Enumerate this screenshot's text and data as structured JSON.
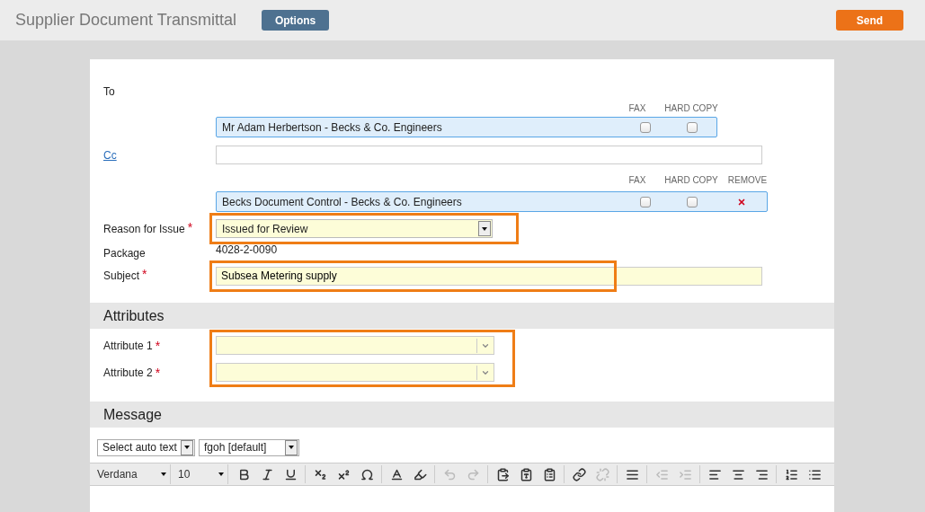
{
  "header": {
    "title": "Supplier Document Transmittal",
    "options_button": "Options",
    "send_button": "Send"
  },
  "to": {
    "label": "To",
    "columns": [
      "FAX",
      "HARD COPY"
    ],
    "recipients": [
      {
        "name": "Mr Adam Herbertson - Becks & Co. Engineers",
        "fax": false,
        "hard_copy": false
      }
    ]
  },
  "cc": {
    "label": "Cc",
    "columns": [
      "FAX",
      "HARD COPY",
      "REMOVE"
    ],
    "recipients": [
      {
        "name": "Becks Document Control - Becks & Co. Engineers",
        "fax": false,
        "hard_copy": false
      }
    ]
  },
  "reason": {
    "label": "Reason for Issue",
    "required": "*",
    "value": "Issued for Review",
    "highlighted": true
  },
  "package": {
    "label": "Package",
    "value": "4028-2-0090"
  },
  "subject": {
    "label": "Subject",
    "required": "*",
    "value": "Subsea Metering supply",
    "highlighted": true
  },
  "attributes": {
    "title": "Attributes",
    "highlighted": true,
    "fields": [
      {
        "label": "Attribute 1",
        "required": "*"
      },
      {
        "label": "Attribute 2",
        "required": "*"
      }
    ]
  },
  "message": {
    "title": "Message",
    "auto_text": "Select auto text",
    "template": "fgoh [default]",
    "font": "Verdana",
    "size": "10",
    "tools": [
      {
        "kind": "bold",
        "disabled": false
      },
      {
        "kind": "italic",
        "disabled": false
      },
      {
        "kind": "underline",
        "disabled": false
      },
      {
        "kind": "sep"
      },
      {
        "kind": "subscript",
        "disabled": false
      },
      {
        "kind": "superscript",
        "disabled": false
      },
      {
        "kind": "omega",
        "disabled": false
      },
      {
        "kind": "sep"
      },
      {
        "kind": "textcolor",
        "disabled": false
      },
      {
        "kind": "bgcolor",
        "disabled": false
      },
      {
        "kind": "sep"
      },
      {
        "kind": "undo",
        "disabled": true
      },
      {
        "kind": "redo",
        "disabled": true
      },
      {
        "kind": "sep"
      },
      {
        "kind": "paste",
        "disabled": false
      },
      {
        "kind": "pastetext",
        "disabled": false
      },
      {
        "kind": "pasteword",
        "disabled": false
      },
      {
        "kind": "sep"
      },
      {
        "kind": "link",
        "disabled": false
      },
      {
        "kind": "unlink",
        "disabled": true
      },
      {
        "kind": "sep"
      },
      {
        "kind": "rule",
        "disabled": false
      },
      {
        "kind": "sep"
      },
      {
        "kind": "outdent",
        "disabled": true
      },
      {
        "kind": "indent",
        "disabled": true
      },
      {
        "kind": "sep"
      },
      {
        "kind": "alignleft",
        "disabled": false
      },
      {
        "kind": "aligncenter",
        "disabled": false
      },
      {
        "kind": "alignright",
        "disabled": false
      },
      {
        "kind": "sep"
      },
      {
        "kind": "numlist",
        "disabled": false
      },
      {
        "kind": "bullist",
        "disabled": false
      }
    ]
  }
}
